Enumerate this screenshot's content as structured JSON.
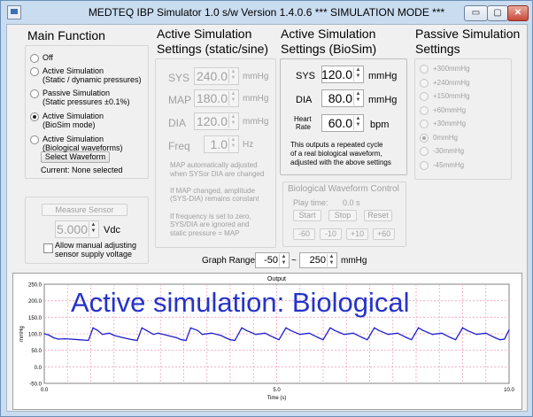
{
  "window": {
    "title": "MEDTEQ IBP Simulator  1.0    s/w Version 1.4.0.6     *** SIMULATION MODE ***",
    "min_glyph": "▭",
    "max_glyph": "▢",
    "close_glyph": "✕"
  },
  "main_function": {
    "heading": "Main Function",
    "options": [
      {
        "label1": "Off",
        "label2": "",
        "selected": false
      },
      {
        "label1": "Active Simulation",
        "label2": "(Static / dynamic pressures)",
        "selected": false
      },
      {
        "label1": "Passive Simulation",
        "label2": "(Static pressures ±0.1%)",
        "selected": false
      },
      {
        "label1": "Active Simulation",
        "label2": "(BioSim mode)",
        "selected": true
      },
      {
        "label1": "Active Simulation",
        "label2": "(Biological waveforms)",
        "selected": false
      }
    ],
    "select_waveform_label": "Select Waveform",
    "current_label": "Current: None selected"
  },
  "measure": {
    "button_label": "Measure Sensor",
    "value": "5.000",
    "unit": "Vdc",
    "checkbox_label1": "Allow manual adjusting",
    "checkbox_label2": "sensor supply voltage"
  },
  "static_sine": {
    "heading1": "Active Simulation",
    "heading2": "Settings (static/sine)",
    "rows": [
      {
        "name": "SYS",
        "value": "240.0",
        "unit": "mmHg"
      },
      {
        "name": "MAP",
        "value": "180.0",
        "unit": "mmHg"
      },
      {
        "name": "DIA",
        "value": "120.0",
        "unit": "mmHg"
      },
      {
        "name": "Freq",
        "value": "1.0",
        "unit": "Hz"
      }
    ],
    "notes": [
      "MAP automatically adjusted",
      "when SYSor DIA are changed",
      "",
      "If MAP changed, amplitude",
      "(SYS-DIA) remains constant",
      "",
      "If frequency is set to zero,",
      "SYS/DIA are ignored and",
      "static pressure = MAP"
    ]
  },
  "biosim": {
    "heading1": "Active Simulation",
    "heading2": "Settings (BioSim)",
    "sys_label": "SYS",
    "sys_value": "120.0",
    "sys_unit": "mmHg",
    "dia_label": "DIA",
    "dia_value": "80.0",
    "dia_unit": "mmHg",
    "hr_label1": "Heart",
    "hr_label2": "Rate",
    "hr_value": "60.0",
    "hr_unit": "bpm",
    "notes": [
      "This outputs a repeated cycle",
      "of a real biological waveform,",
      "adjusted with the above settings"
    ]
  },
  "bio_control": {
    "heading": "Biological Waveform Control",
    "play_label": "Play time:",
    "play_value": "0.0 s",
    "buttons": [
      "Start",
      "Stop",
      "Reset"
    ],
    "step_buttons": [
      "-60",
      "-10",
      "+10",
      "+60"
    ]
  },
  "passive": {
    "heading1": "Passive Simulation",
    "heading2": "Settings",
    "options": [
      {
        "label": "+300mmHg",
        "selected": false
      },
      {
        "label": "+240mmHg",
        "selected": false
      },
      {
        "label": "+150mmHg",
        "selected": false
      },
      {
        "label": "+60mmHg",
        "selected": false
      },
      {
        "label": "+30mmHg",
        "selected": false
      },
      {
        "label": "0mmHg",
        "selected": true
      },
      {
        "label": "-30mmHg",
        "selected": false
      },
      {
        "label": "-45mmHg",
        "selected": false
      }
    ]
  },
  "graph_range": {
    "label": "Graph Range:",
    "min": "-50",
    "sep": "~",
    "max": "250",
    "unit": "mmHg"
  },
  "chart_data": {
    "type": "line",
    "title": "Output",
    "xlabel": "Time (s)",
    "ylabel": "mmHg",
    "overlay_text": "Active simulation: Biological",
    "xlim": [
      0,
      10
    ],
    "ylim": [
      -50,
      250
    ],
    "x_ticks": [
      "0.0",
      "5.0",
      "10.0"
    ],
    "y_ticks": [
      "250.0",
      "200.0",
      "150.0",
      "100.0",
      "50.0",
      "0.0",
      "-50.0"
    ],
    "grid": true,
    "line_color": "#1f1fd0",
    "grid_color": "#f2a0b8",
    "series": [
      {
        "x": [
          0.0,
          0.1,
          0.2,
          0.3,
          0.45,
          0.55,
          0.75,
          0.95,
          1.05,
          1.15,
          1.25,
          1.4,
          1.5,
          1.7,
          1.9,
          2.0,
          2.1,
          2.2,
          2.35,
          2.45,
          2.65,
          2.85,
          2.95,
          3.05,
          3.15,
          3.3,
          3.4,
          3.6,
          3.8,
          3.9,
          4.0,
          4.1,
          4.25,
          4.35,
          4.55,
          4.75,
          4.85,
          4.95,
          5.05,
          5.2,
          5.3,
          5.5,
          5.7,
          5.8,
          5.9,
          6.0,
          6.15,
          6.25,
          6.45,
          6.65,
          6.75,
          6.85,
          6.95,
          7.1,
          7.2,
          7.4,
          7.6,
          7.7,
          7.8,
          7.9,
          8.05,
          8.15,
          8.35,
          8.55,
          8.65,
          8.75,
          8.85,
          9.0,
          9.1,
          9.3,
          9.5,
          9.6,
          9.7,
          9.8,
          9.9,
          10.0
        ],
        "y": [
          100,
          96,
          88,
          84,
          85,
          84,
          82,
          80,
          118,
          110,
          98,
          102,
          95,
          88,
          82,
          80,
          118,
          110,
          98,
          102,
          95,
          88,
          82,
          80,
          118,
          110,
          98,
          102,
          95,
          88,
          82,
          80,
          118,
          110,
          98,
          102,
          95,
          88,
          82,
          118,
          110,
          98,
          102,
          95,
          88,
          82,
          118,
          110,
          98,
          102,
          95,
          88,
          82,
          118,
          110,
          98,
          102,
          95,
          88,
          82,
          118,
          110,
          98,
          102,
          95,
          88,
          82,
          118,
          110,
          98,
          102,
          95,
          88,
          82,
          84,
          112
        ]
      }
    ]
  }
}
